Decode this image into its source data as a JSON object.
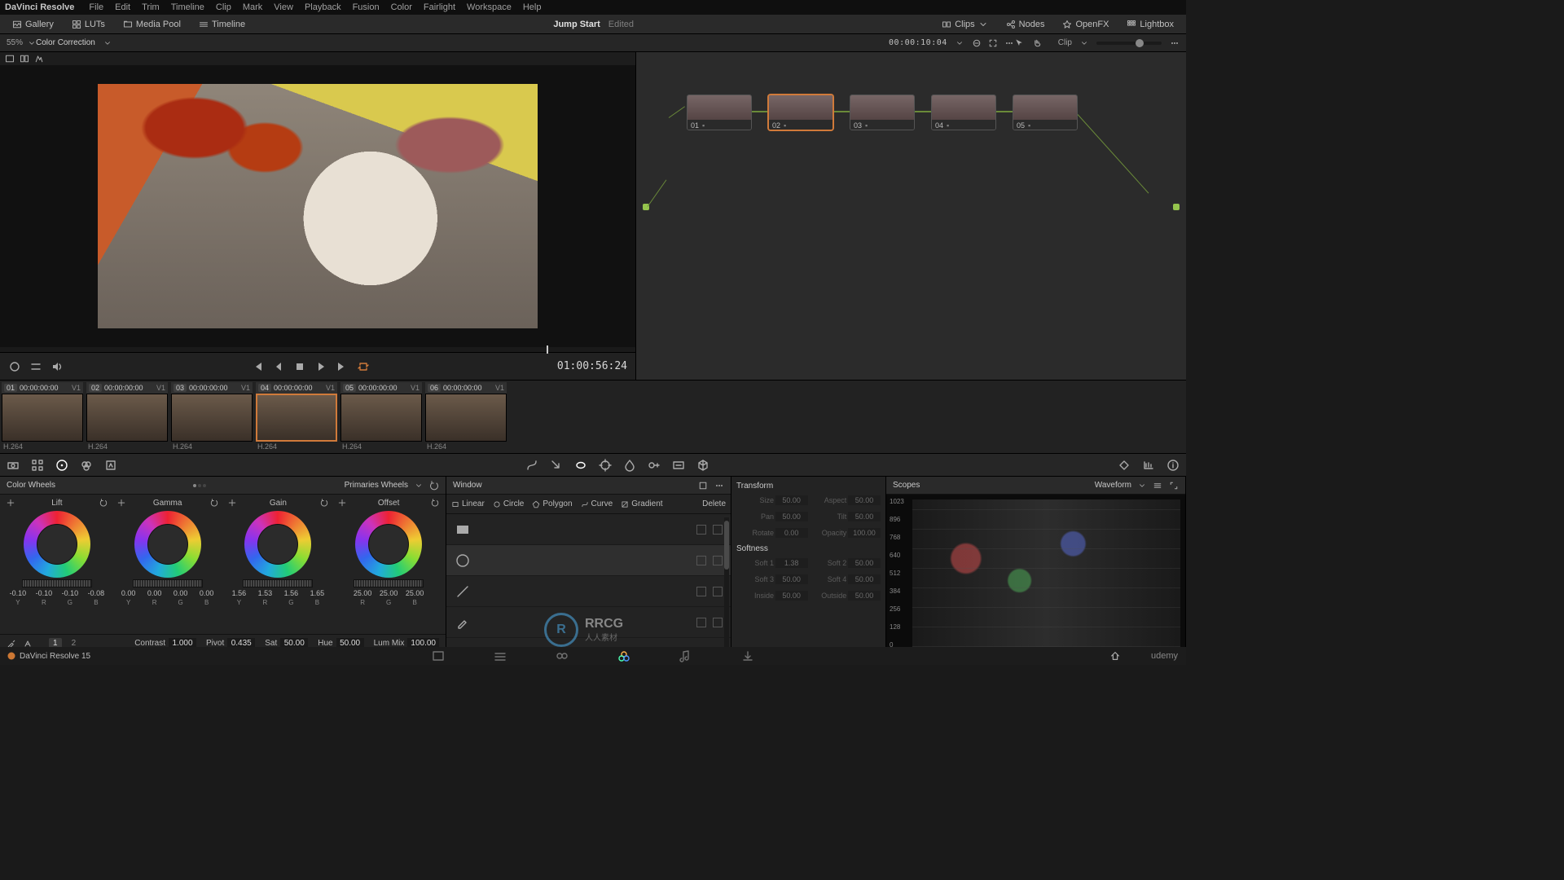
{
  "menubar": {
    "app": "DaVinci Resolve",
    "items": [
      "File",
      "Edit",
      "Trim",
      "Timeline",
      "Clip",
      "Mark",
      "View",
      "Playback",
      "Fusion",
      "Color",
      "Fairlight",
      "Workspace",
      "Help"
    ]
  },
  "toolbar": {
    "left": [
      {
        "k": "gallery",
        "l": "Gallery"
      },
      {
        "k": "luts",
        "l": "LUTs"
      },
      {
        "k": "media",
        "l": "Media Pool"
      },
      {
        "k": "timeline",
        "l": "Timeline"
      }
    ],
    "project": "Jump Start",
    "edited": "Edited",
    "right": [
      {
        "k": "clips",
        "l": "Clips"
      },
      {
        "k": "nodes",
        "l": "Nodes"
      },
      {
        "k": "openfx",
        "l": "OpenFX"
      },
      {
        "k": "lightbox",
        "l": "Lightbox"
      }
    ]
  },
  "subhdr": {
    "zoom": "55%",
    "mode": "Color Correction",
    "tc": "00:00:10:04",
    "clip_label": "Clip"
  },
  "viewer": {
    "timecode": "01:00:56:24"
  },
  "nodes": [
    {
      "id": "01",
      "sel": false
    },
    {
      "id": "02",
      "sel": true
    },
    {
      "id": "03",
      "sel": false
    },
    {
      "id": "04",
      "sel": false
    },
    {
      "id": "05",
      "sel": false
    }
  ],
  "clips": [
    {
      "idx": "01",
      "tc": "00:00:00:00",
      "v": "V1",
      "codec": "H.264"
    },
    {
      "idx": "02",
      "tc": "00:00:00:00",
      "v": "V1",
      "codec": "H.264"
    },
    {
      "idx": "03",
      "tc": "00:00:00:00",
      "v": "V1",
      "codec": "H.264"
    },
    {
      "idx": "04",
      "tc": "00:00:00:00",
      "v": "V1",
      "codec": "H.264",
      "sel": true
    },
    {
      "idx": "05",
      "tc": "00:00:00:00",
      "v": "V1",
      "codec": "H.264"
    },
    {
      "idx": "06",
      "tc": "00:00:00:00",
      "v": "V1",
      "codec": "H.264"
    }
  ],
  "colorwheels": {
    "title": "Color Wheels",
    "mode": "Primaries Wheels",
    "wheels": [
      {
        "name": "Lift",
        "vals": [
          "-0.10",
          "-0.10",
          "-0.10",
          "-0.08"
        ],
        "labs": [
          "Y",
          "R",
          "G",
          "B"
        ]
      },
      {
        "name": "Gamma",
        "vals": [
          "0.00",
          "0.00",
          "0.00",
          "0.00"
        ],
        "labs": [
          "Y",
          "R",
          "G",
          "B"
        ]
      },
      {
        "name": "Gain",
        "vals": [
          "1.56",
          "1.53",
          "1.56",
          "1.65"
        ],
        "labs": [
          "Y",
          "R",
          "G",
          "B"
        ]
      },
      {
        "name": "Offset",
        "vals": [
          "25.00",
          "25.00",
          "25.00"
        ],
        "labs": [
          "R",
          "G",
          "B"
        ]
      }
    ],
    "adj": {
      "contrast": "1.000",
      "pivot": "0.435",
      "sat": "50.00",
      "hue": "50.00",
      "lummix": "100.00",
      "tabs": [
        "1",
        "2"
      ]
    }
  },
  "windowpanel": {
    "title": "Window",
    "shapes": [
      {
        "k": "rect",
        "l": "Linear"
      },
      {
        "k": "circle",
        "l": "Circle"
      },
      {
        "k": "poly",
        "l": "Polygon"
      },
      {
        "k": "curve",
        "l": "Curve"
      },
      {
        "k": "grad",
        "l": "Gradient"
      }
    ],
    "delete": "Delete"
  },
  "transform": {
    "title": "Transform",
    "rows": [
      [
        "Size",
        "50.00",
        "Aspect",
        "50.00"
      ],
      [
        "Pan",
        "50.00",
        "Tilt",
        "50.00"
      ],
      [
        "Rotate",
        "0.00",
        "Opacity",
        "100.00"
      ]
    ],
    "soft_title": "Softness",
    "soft": [
      [
        "Soft 1",
        "1.38",
        "Soft 2",
        "50.00"
      ],
      [
        "Soft 3",
        "50.00",
        "Soft 4",
        "50.00"
      ],
      [
        "Inside",
        "50.00",
        "Outside",
        "50.00"
      ]
    ]
  },
  "scopes": {
    "title": "Scopes",
    "mode": "Waveform",
    "ticks": [
      "1023",
      "896",
      "768",
      "640",
      "512",
      "384",
      "256",
      "128",
      "0"
    ]
  },
  "status": {
    "version": "DaVinci Resolve 15",
    "brand": "udemy"
  },
  "watermark": {
    "main": "RRCG",
    "sub": "人人素材"
  }
}
